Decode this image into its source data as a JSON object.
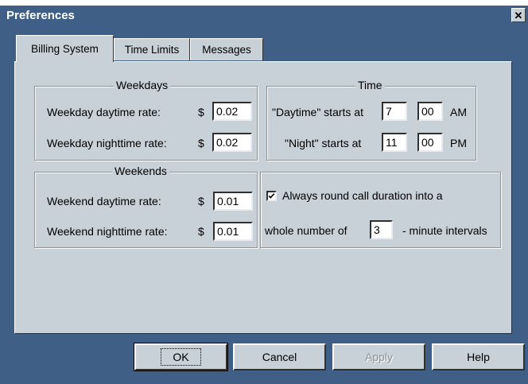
{
  "window": {
    "title": "Preferences",
    "close_glyph": "✕"
  },
  "tabs": [
    {
      "label": "Billing System",
      "active": true
    },
    {
      "label": "Time Limits",
      "active": false
    },
    {
      "label": "Messages",
      "active": false
    }
  ],
  "weekdays": {
    "legend": "Weekdays",
    "daytime_label": "Weekday daytime rate:",
    "daytime_currency": "$",
    "daytime_value": "0.02",
    "nighttime_label": "Weekday nighttime rate:",
    "nighttime_currency": "$",
    "nighttime_value": "0.02"
  },
  "time": {
    "legend": "Time",
    "daytime_label": "\"Daytime\" starts at",
    "daytime_hour": "7",
    "daytime_minute": "00",
    "daytime_ampm": "AM",
    "night_label": "\"Night\" starts at",
    "night_hour": "11",
    "night_minute": "00",
    "night_ampm": "PM"
  },
  "weekends": {
    "legend": "Weekends",
    "daytime_label": "Weekend daytime rate:",
    "daytime_currency": "$",
    "daytime_value": "0.01",
    "nighttime_label": "Weekend nighttime rate:",
    "nighttime_currency": "$",
    "nighttime_value": "0.01"
  },
  "rounding": {
    "checked": true,
    "check_label": "Always round call duration into a",
    "prefix": "whole number of",
    "interval_value": "3",
    "suffix": "- minute intervals"
  },
  "buttons": {
    "ok": "OK",
    "cancel": "Cancel",
    "apply": "Apply",
    "help": "Help"
  },
  "colors": {
    "titlebar": "#3f5f86",
    "face": "#c8d0d8"
  }
}
